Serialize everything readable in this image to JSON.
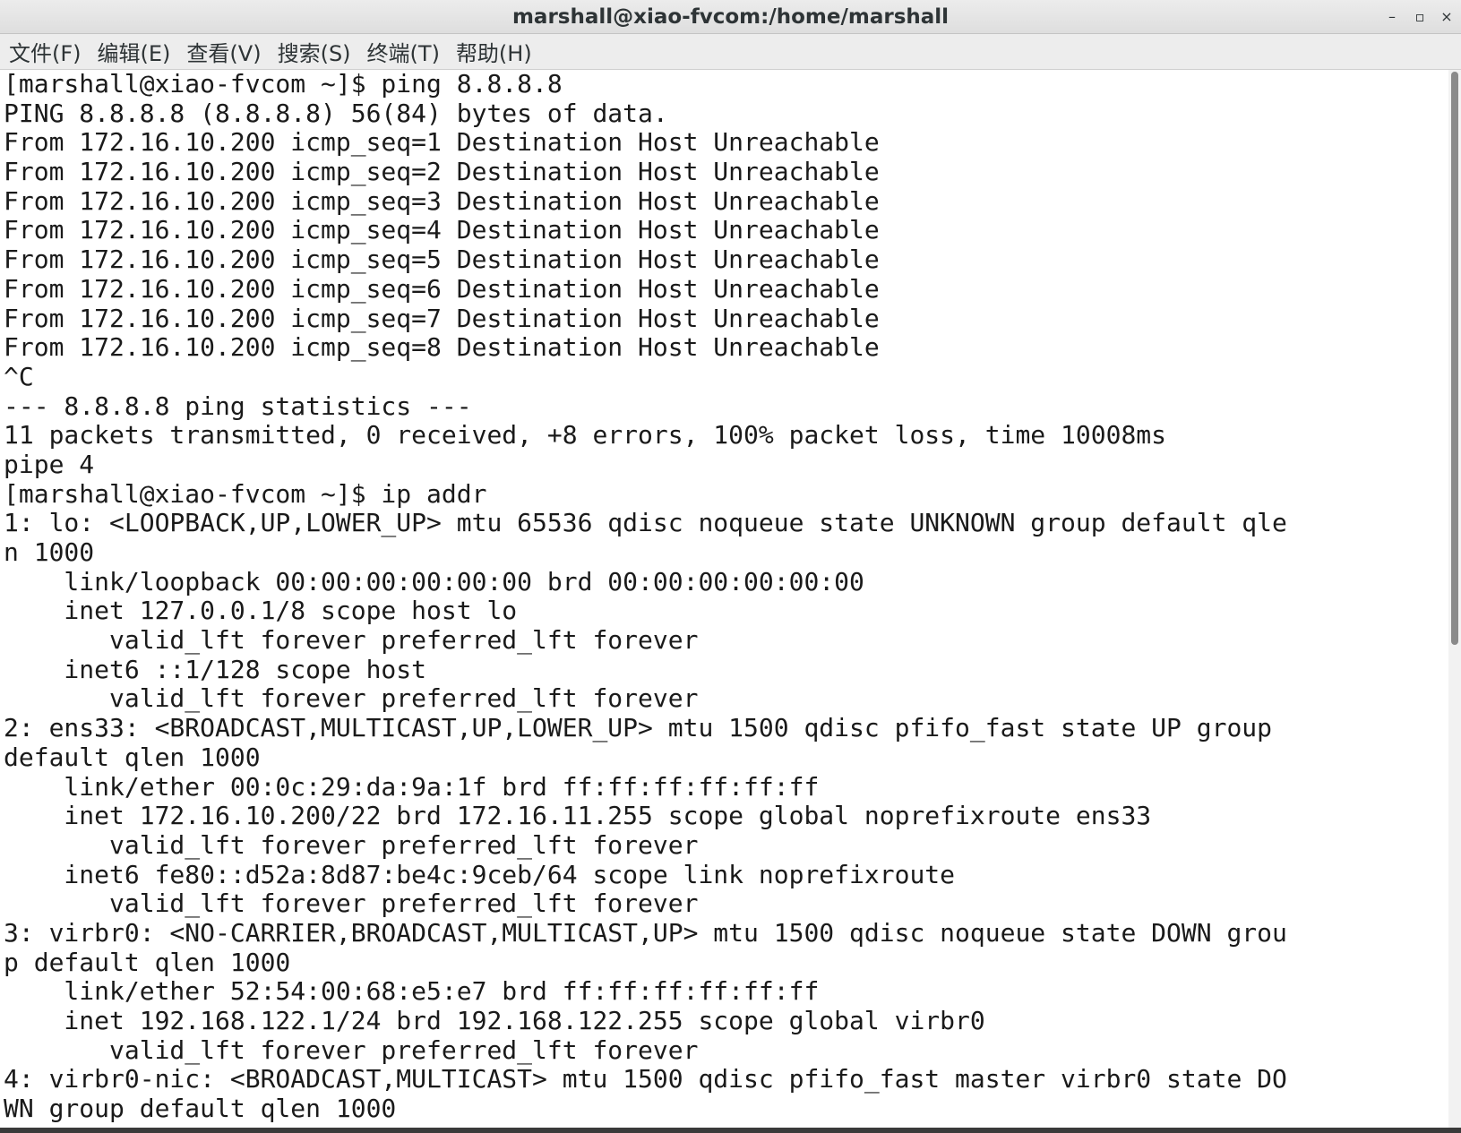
{
  "window": {
    "title": "marshall@xiao-fvcom:/home/marshall",
    "minimize_label": "–",
    "maximize_label": "▫",
    "close_label": "×"
  },
  "menu": {
    "items": [
      "文件(F)",
      "编辑(E)",
      "查看(V)",
      "搜索(S)",
      "终端(T)",
      "帮助(H)"
    ]
  },
  "terminal": {
    "lines": [
      "[marshall@xiao-fvcom ~]$ ping 8.8.8.8",
      "PING 8.8.8.8 (8.8.8.8) 56(84) bytes of data.",
      "From 172.16.10.200 icmp_seq=1 Destination Host Unreachable",
      "From 172.16.10.200 icmp_seq=2 Destination Host Unreachable",
      "From 172.16.10.200 icmp_seq=3 Destination Host Unreachable",
      "From 172.16.10.200 icmp_seq=4 Destination Host Unreachable",
      "From 172.16.10.200 icmp_seq=5 Destination Host Unreachable",
      "From 172.16.10.200 icmp_seq=6 Destination Host Unreachable",
      "From 172.16.10.200 icmp_seq=7 Destination Host Unreachable",
      "From 172.16.10.200 icmp_seq=8 Destination Host Unreachable",
      "^C",
      "--- 8.8.8.8 ping statistics ---",
      "11 packets transmitted, 0 received, +8 errors, 100% packet loss, time 10008ms",
      "pipe 4",
      "[marshall@xiao-fvcom ~]$ ip addr",
      "1: lo: <LOOPBACK,UP,LOWER_UP> mtu 65536 qdisc noqueue state UNKNOWN group default qle",
      "n 1000",
      "    link/loopback 00:00:00:00:00:00 brd 00:00:00:00:00:00",
      "    inet 127.0.0.1/8 scope host lo",
      "       valid_lft forever preferred_lft forever",
      "    inet6 ::1/128 scope host",
      "       valid_lft forever preferred_lft forever",
      "2: ens33: <BROADCAST,MULTICAST,UP,LOWER_UP> mtu 1500 qdisc pfifo_fast state UP group",
      "default qlen 1000",
      "    link/ether 00:0c:29:da:9a:1f brd ff:ff:ff:ff:ff:ff",
      "    inet 172.16.10.200/22 brd 172.16.11.255 scope global noprefixroute ens33",
      "       valid_lft forever preferred_lft forever",
      "    inet6 fe80::d52a:8d87:be4c:9ceb/64 scope link noprefixroute",
      "       valid_lft forever preferred_lft forever",
      "3: virbr0: <NO-CARRIER,BROADCAST,MULTICAST,UP> mtu 1500 qdisc noqueue state DOWN grou",
      "p default qlen 1000",
      "    link/ether 52:54:00:68:e5:e7 brd ff:ff:ff:ff:ff:ff",
      "    inet 192.168.122.1/24 brd 192.168.122.255 scope global virbr0",
      "       valid_lft forever preferred_lft forever",
      "4: virbr0-nic: <BROADCAST,MULTICAST> mtu 1500 qdisc pfifo_fast master virbr0 state DO",
      "WN group default qlen 1000"
    ]
  },
  "colors": {
    "background": "#ffffff",
    "text": "#1a1a1a",
    "titlebar": "#e5e5e5",
    "menubar": "#ededed"
  }
}
